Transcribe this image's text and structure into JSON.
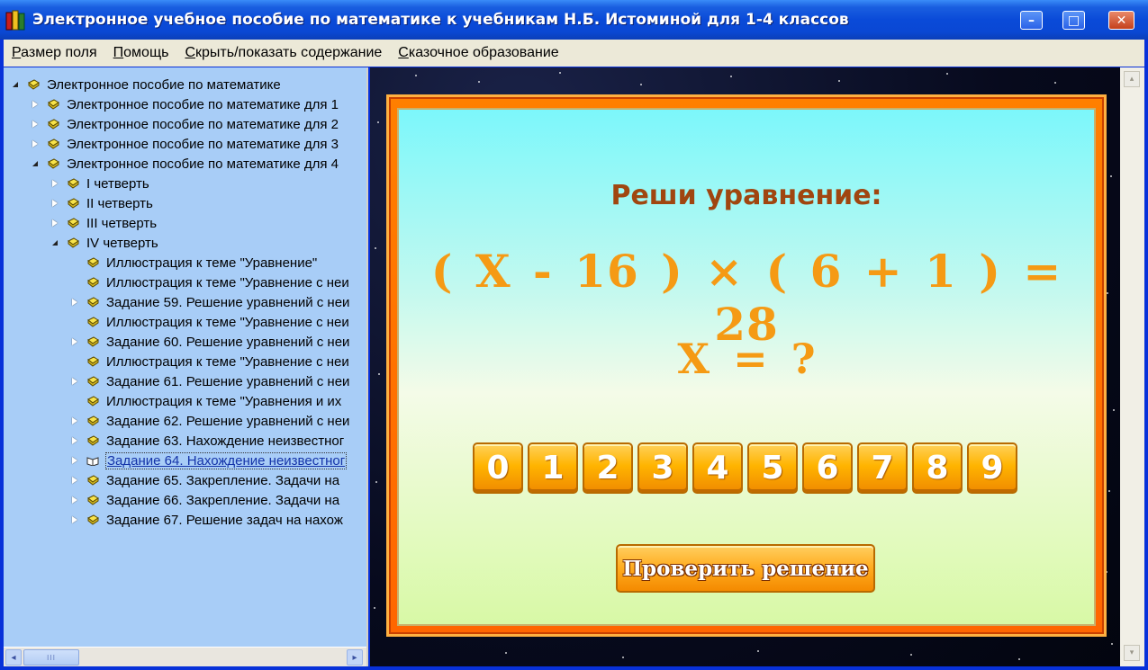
{
  "window": {
    "title": "Электронное учебное пособие по математике к учебникам Н.Б. Истоминой для 1-4 классов",
    "minimize_label": "–",
    "maximize_label": "□",
    "close_label": "✕"
  },
  "menu": [
    "Размер поля",
    "Помощь",
    "Скрыть/показать содержание",
    "Сказочное образование"
  ],
  "tree": [
    {
      "label": "Электронное пособие по математике",
      "level": 0,
      "expander": "open"
    },
    {
      "label": "Электронное пособие по математике для 1",
      "level": 1,
      "expander": "closed"
    },
    {
      "label": "Электронное пособие по математике для 2",
      "level": 1,
      "expander": "closed"
    },
    {
      "label": "Электронное пособие по математике для 3",
      "level": 1,
      "expander": "closed"
    },
    {
      "label": "Электронное пособие по математике для 4",
      "level": 1,
      "expander": "open"
    },
    {
      "label": "I четверть",
      "level": 2,
      "expander": "closed"
    },
    {
      "label": "II четверть",
      "level": 2,
      "expander": "closed"
    },
    {
      "label": "III четверть",
      "level": 2,
      "expander": "closed"
    },
    {
      "label": "IV четверть",
      "level": 2,
      "expander": "open"
    },
    {
      "label": "Иллюстрация к теме \"Уравнение\"",
      "level": 3,
      "expander": "none"
    },
    {
      "label": "Иллюстрация к теме \"Уравнение с неи",
      "level": 3,
      "expander": "none"
    },
    {
      "label": "Задание 59. Решение уравнений с неи",
      "level": 3,
      "expander": "closed"
    },
    {
      "label": "Иллюстрация к теме \"Уравнение с неи",
      "level": 3,
      "expander": "none"
    },
    {
      "label": "Задание 60. Решение уравнений с неи",
      "level": 3,
      "expander": "closed"
    },
    {
      "label": "Иллюстрация к теме \"Уравнение с неи",
      "level": 3,
      "expander": "none"
    },
    {
      "label": "Задание 61. Решение уравнений с неи",
      "level": 3,
      "expander": "closed"
    },
    {
      "label": "Иллюстрация к теме \"Уравнения и их",
      "level": 3,
      "expander": "none"
    },
    {
      "label": "Задание 62. Решение уравнений с неи",
      "level": 3,
      "expander": "closed"
    },
    {
      "label": "Задание 63. Нахождение неизвестног",
      "level": 3,
      "expander": "closed"
    },
    {
      "label": "Задание 64. Нахождение неизвестног",
      "level": 3,
      "expander": "closed",
      "selected": true
    },
    {
      "label": "Задание 65. Закрепление. Задачи на",
      "level": 3,
      "expander": "closed"
    },
    {
      "label": "Задание 66. Закрепление. Задачи на",
      "level": 3,
      "expander": "closed"
    },
    {
      "label": "Задание 67. Решение задач на нахож",
      "level": 3,
      "expander": "closed"
    }
  ],
  "tree_scroll": {
    "left_arrow": "◂",
    "right_arrow": "▸",
    "thumb_grip": "III"
  },
  "exercise": {
    "prompt": "Реши уравнение:",
    "equation": "( X - 16 ) × ( 6 + 1 ) = 28",
    "question": "X = ?",
    "digits": [
      "0",
      "1",
      "2",
      "3",
      "4",
      "5",
      "6",
      "7",
      "8",
      "9"
    ],
    "check_button": "Проверить решение"
  },
  "content_scroll": {
    "up_arrow": "▴",
    "down_arrow": "▾"
  },
  "colors": {
    "titlebar": "#0a4ad8",
    "tree_background": "#a8cdf7",
    "frame_orange": "#ff6600",
    "digit_orange": "#ffb400",
    "equation_text": "#f59a14",
    "prompt_text": "#a04610"
  }
}
